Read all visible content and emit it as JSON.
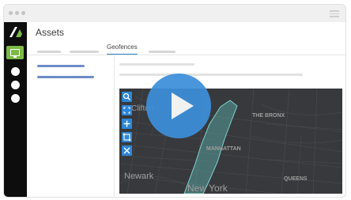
{
  "page": {
    "title": "Assets"
  },
  "tabs": {
    "active_label": "Geofences"
  },
  "map": {
    "labels": {
      "clifton": "Clifton",
      "bronx": "THE BRONX",
      "manhattan": "MANHATTAN",
      "newark": "Newark",
      "queens": "QUEENS",
      "new_york": "New York"
    },
    "tools": [
      "search-icon",
      "expand-icon",
      "add-icon",
      "select-area-icon",
      "close-icon"
    ]
  },
  "colors": {
    "accent_green": "#7cb946",
    "accent_blue": "#2f7fc1",
    "tool_blue": "#2e86d6",
    "geofence_fill": "#5a9e9a",
    "play_button": "#3d8fda",
    "map_background": "#37393c"
  }
}
